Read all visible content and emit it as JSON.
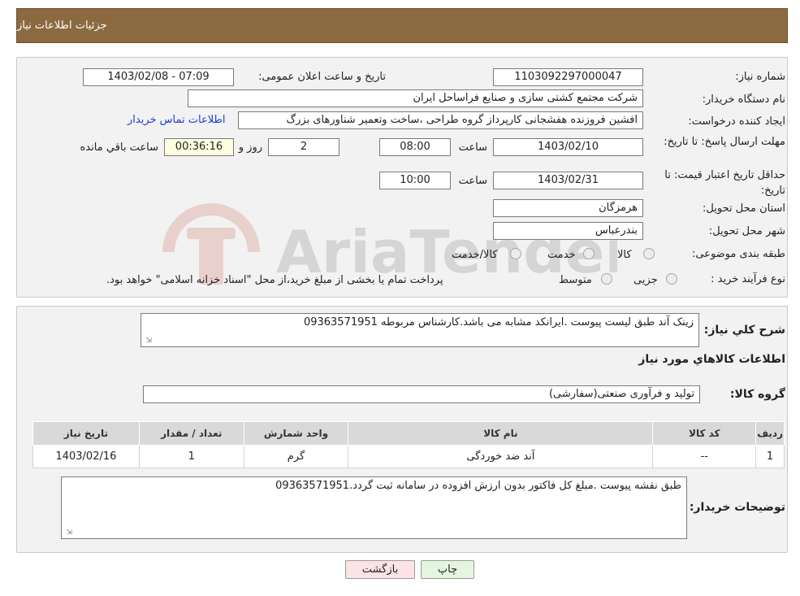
{
  "header": {
    "title": "جزئیات اطلاعات نیاز"
  },
  "form": {
    "need_number_label": "شماره نیاز:",
    "need_number": "1103092297000047",
    "announce_label": "تاریخ و ساعت اعلان عمومی:",
    "announce_value": "1403/02/08 - 07:09",
    "buyer_org_label": "نام دستگاه خریدار:",
    "buyer_org": "شرکت مجتمع کشتی سازی و صنایع فراساحل ایران",
    "requester_label": "ایجاد کننده درخواست:",
    "requester": "افشین فروزنده هفشجانی کارپرداز گروه طراحی ،ساخت وتعمیر شناورهای بزرگ",
    "contact_link": "اطلاعات تماس خریدار",
    "reply_deadline_label": "مهلت ارسال پاسخ: تا تاریخ:",
    "reply_date": "1403/02/10",
    "time_label": "ساعت",
    "reply_time": "08:00",
    "days_value": "2",
    "days_label": "روز و",
    "remaining_time": "00:36:16",
    "remaining_label": "ساعت باقي مانده",
    "validity_label": "حداقل تاریخ اعتبار قیمت: تا تاریخ:",
    "validity_date": "1403/02/31",
    "validity_time": "10:00",
    "province_label": "استان محل تحویل:",
    "province": "هرمزگان",
    "city_label": "شهر محل تحویل:",
    "city": "بندرعباس",
    "category_label": "طبقه بندی موضوعی:",
    "category_options": [
      "کالا",
      "خدمت",
      "کالا/خدمت"
    ],
    "process_label": "نوع فرآیند خرید :",
    "process_options": [
      "جزیی",
      "متوسط"
    ],
    "process_note": "پرداخت تمام یا بخشی از مبلغ خرید،از محل \"اسناد خزانه اسلامی\" خواهد بود."
  },
  "details": {
    "summary_label": "شرح کلي نياز:",
    "summary": "زینک آند طبق لیست پیوست .ایرانکد مشابه می باشد.کارشناس مربوطه 09363571951",
    "goods_title": "اطلاعات کالاهاي مورد نياز",
    "group_label": "گروه کالا:",
    "group_value": "تولید و فرآوری صنعتی(سفارشی)",
    "table": {
      "headers": [
        "ردیف",
        "کد کالا",
        "نام کالا",
        "واحد شمارش",
        "تعداد / مقدار",
        "تاریخ نیاز"
      ],
      "rows": [
        [
          "1",
          "--",
          "آند ضد خوردگی",
          "گرم",
          "1",
          "1403/02/16"
        ]
      ]
    },
    "buyer_notes_label": "توضیحات خریدار:",
    "buyer_notes": "طبق نقشه پیوست .مبلغ کل فاکتور بدون ارزش افزوده در سامانه ثبت گردد.09363571951"
  },
  "buttons": {
    "print": "چاپ",
    "back": "بازگشت"
  },
  "watermark": {
    "text": "AriaTender.neT"
  },
  "colors": {
    "header_bg": "#8b6a3f",
    "panel_bg": "#f2f2f2",
    "link": "#1a3fd6",
    "back_btn_bg": "#fbe3e6",
    "print_btn_bg": "#e4f6df"
  }
}
